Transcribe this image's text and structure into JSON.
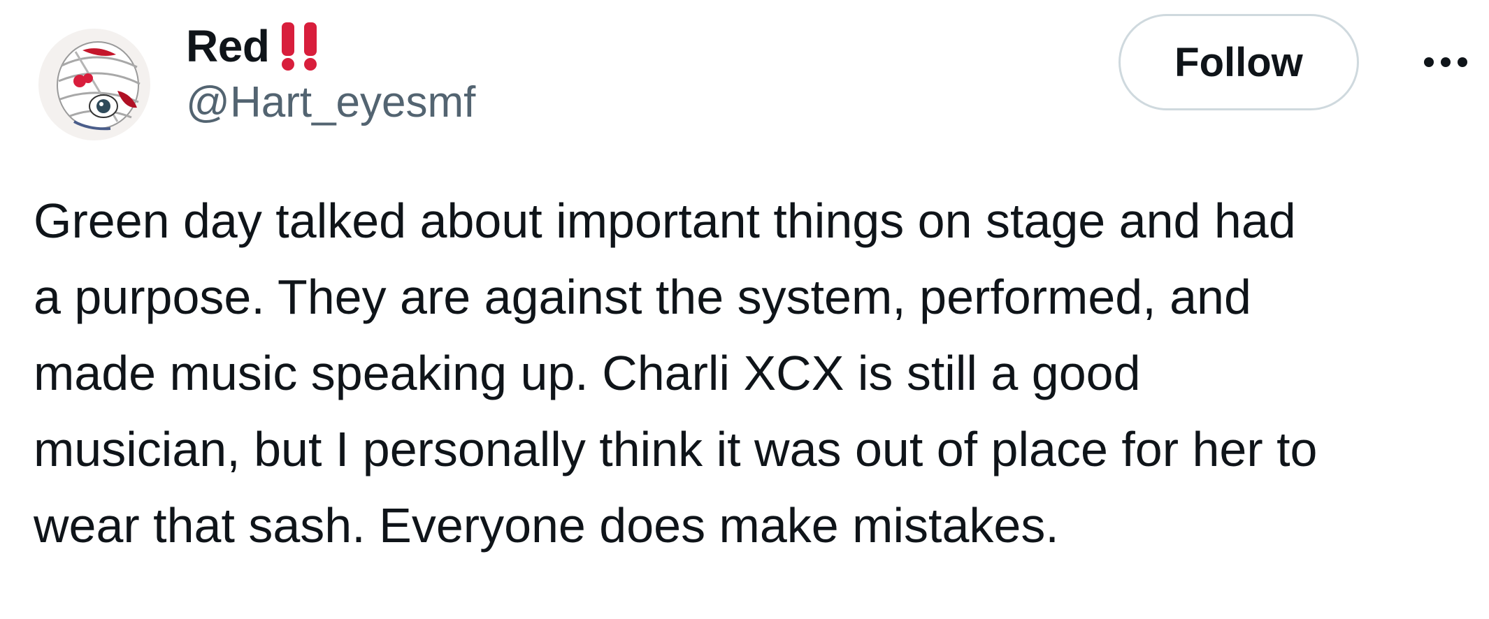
{
  "author": {
    "display_name": "Red",
    "display_name_emoji": "‼️",
    "handle": "@Hart_eyesmf"
  },
  "actions": {
    "follow_label": "Follow",
    "more_icon": "ellipsis-icon"
  },
  "tweet": {
    "lines": [
      "Green day talked about important things on stage and had",
      "a purpose. They are against the system, performed, and",
      "made music speaking up. Charli XCX is still a good",
      "musician, but I personally think it was out of place for her to",
      "wear that sash. Everyone does make mistakes."
    ]
  },
  "colors": {
    "text_primary": "#0f1419",
    "text_secondary": "#536471",
    "follow_border": "#cfd9de",
    "emoji_red": "#d81e3c"
  }
}
